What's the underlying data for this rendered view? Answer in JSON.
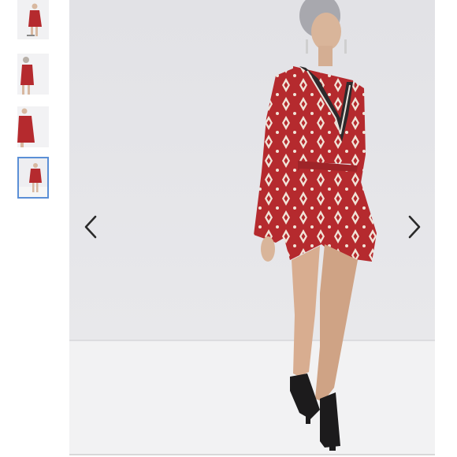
{
  "gallery": {
    "thumbnails": [
      {
        "name": "thumbnail-1",
        "selected": false
      },
      {
        "name": "thumbnail-2",
        "selected": false
      },
      {
        "name": "thumbnail-3",
        "selected": false
      },
      {
        "name": "thumbnail-4",
        "selected": true
      }
    ],
    "selected_index": 4,
    "prev_icon": "chevron-left-icon",
    "next_icon": "chevron-right-icon",
    "selected_border_color": "#5b8fd6",
    "garment_color": "#b52a2e",
    "background_color": "#e5e5e8"
  }
}
